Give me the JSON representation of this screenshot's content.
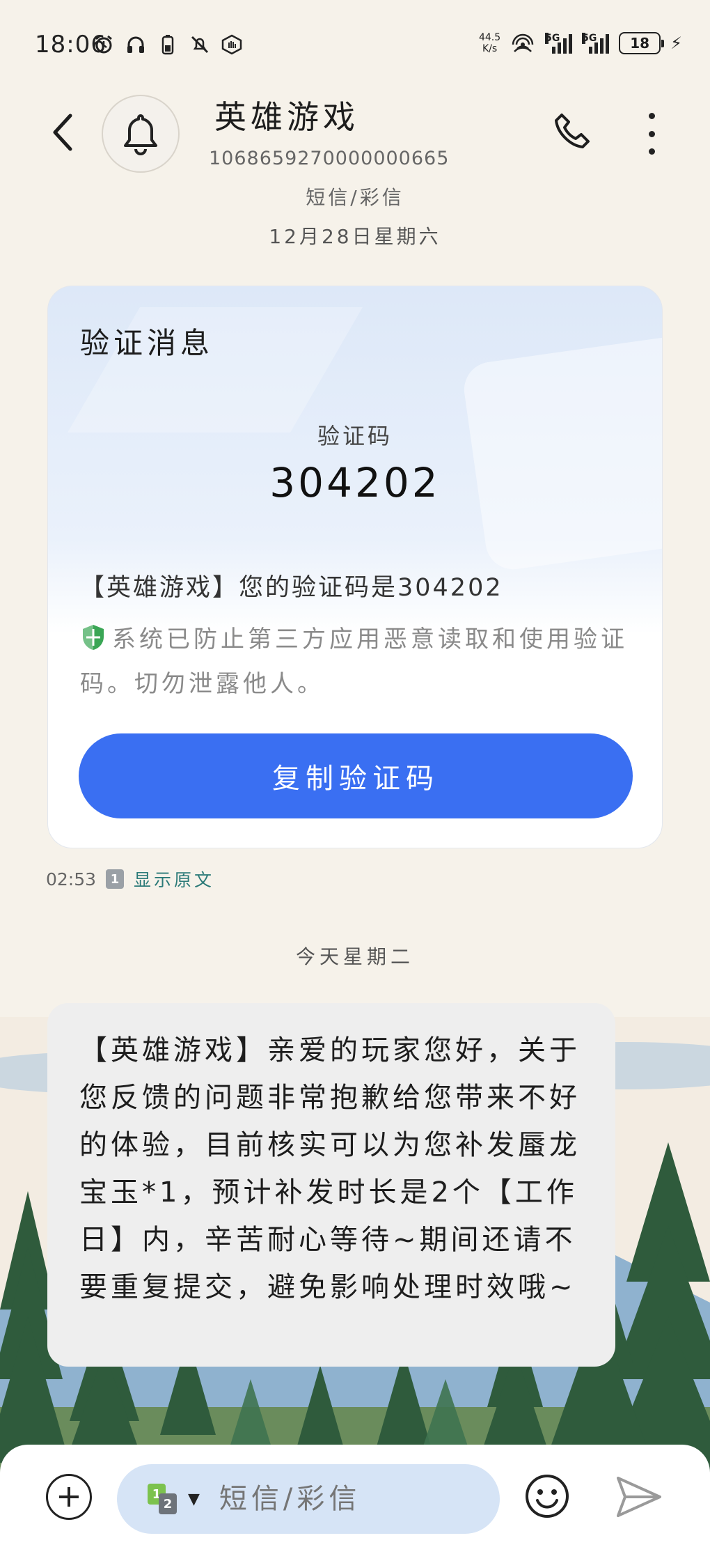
{
  "status_bar": {
    "time": "18:06",
    "net_speed_value": "44.5",
    "net_speed_unit": "K/s",
    "signal1_label": "5G",
    "signal2_label": "5G",
    "battery_level": "18"
  },
  "header": {
    "contact_name": "英雄游戏",
    "contact_number": "1068659270000000665",
    "message_type": "短信/彩信",
    "date_label": "12月28日星期六"
  },
  "verification_card": {
    "title": "验证消息",
    "code_label": "验证码",
    "code_value": "304202",
    "message": "【英雄游戏】您的验证码是304202",
    "security_note": "系统已防止第三方应用恶意读取和使用验证码。切勿泄露他人。",
    "copy_button_label": "复制验证码"
  },
  "message_meta": {
    "time": "02:53",
    "sim_badge": "1",
    "show_original_label": "显示原文"
  },
  "day_separator": "今天星期二",
  "bubble": {
    "text": "【英雄游戏】亲爱的玩家您好，关于您反馈的问题非常抱歉给您带来不好的体验，目前核实可以为您补发蜃龙宝玉*1，预计补发时长是2个【工作日】内，辛苦耐心等待~期间还请不要重复提交，避免影响处理时效哦~"
  },
  "input_bar": {
    "placeholder": "短信/彩信",
    "sim1": "1",
    "sim2": "2"
  },
  "colors": {
    "accent_button": "#3a6ff2",
    "link": "#2b7a78",
    "shield": "#3aa655"
  }
}
